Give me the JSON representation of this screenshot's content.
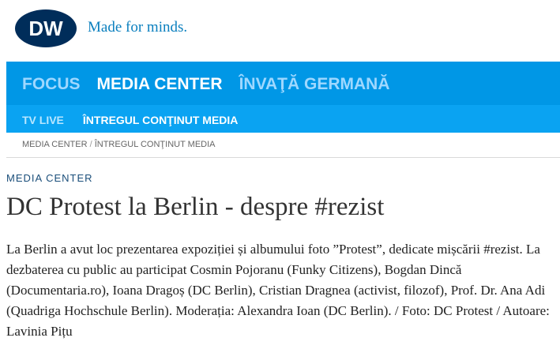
{
  "brand": {
    "logo_text": "DW",
    "tagline": "Made for minds."
  },
  "nav": {
    "main": [
      "FOCUS",
      "MEDIA CENTER",
      "ÎNVAŢĂ GERMANĂ"
    ],
    "sub": [
      "TV LIVE",
      "ÎNTREGUL CONŢINUT MEDIA"
    ]
  },
  "breadcrumb": [
    "MEDIA CENTER",
    "ÎNTREGUL CONŢINUT MEDIA"
  ],
  "breadcrumb_separator": "/",
  "article": {
    "section": "MEDIA CENTER",
    "title": "DC Protest la Berlin - despre #rezist",
    "description": "La Berlin a avut loc prezentarea expoziției și albumului foto ”Protest”, dedicate mișcării #rezist. La dezbaterea cu public au participat Cosmin Pojoranu (Funky Citizens), Bogdan Dincă (Documentaria.ro), Ioana Dragoș (DC Berlin), Cristian Dragnea (activist, filozof), Prof. Dr. Ana Adi (Quadriga Hochschule Berlin). Moderația: Alexandra Ioan (DC Berlin). / Foto: DC Protest / Autoare: Lavinia Pițu"
  },
  "colors": {
    "nav_blue": "#0097e6",
    "subnav_blue": "#0aa3f2",
    "brand_blue": "#0a7fbe",
    "logo_dark": "#002d5a"
  }
}
